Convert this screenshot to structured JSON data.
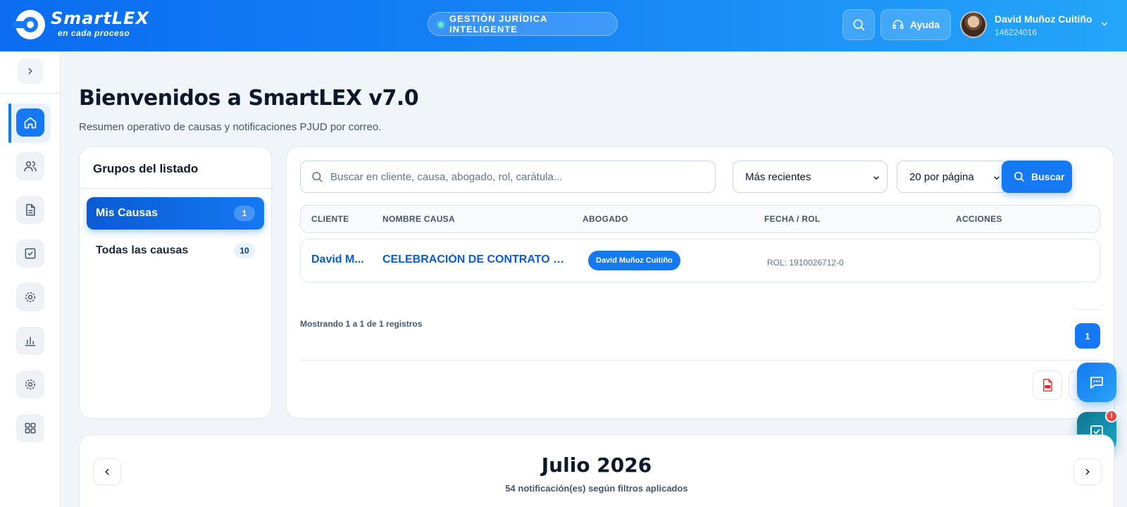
{
  "header": {
    "brand": "SmartLEX",
    "tagline": "en cada proceso",
    "center_pill": "GESTIÓN JURÍDICA INTELIGENTE",
    "help_label": "Ayuda",
    "user_name": "David Muñoz Cuitiño",
    "user_id": "146224016"
  },
  "page": {
    "title": "Bienvenidos a SmartLEX v7.0",
    "subtitle": "Resumen operativo de causas y notificaciones PJUD por correo."
  },
  "groups": {
    "title": "Grupos del listado",
    "items": [
      {
        "label": "Mis Causas",
        "count": "1"
      },
      {
        "label": "Todas las causas",
        "count": "10"
      }
    ]
  },
  "search": {
    "placeholder": "Buscar en cliente, causa, abogado, rol, carátula...",
    "sort_value": "Más recientes",
    "per_page_value": "20 por página",
    "button_label": "Buscar"
  },
  "table": {
    "headers": [
      "CLIENTE",
      "NOMBRE CAUSA",
      "ABOGADO",
      "FECHA / ROL",
      "ACCIONES"
    ],
    "rows": [
      {
        "client": "David M...",
        "cause": "CELEBRACIÓN DE CONTRATO SI...",
        "lawyer": "David Muñoz Cuitiño",
        "rol": "ROL: 1910026712-0"
      }
    ],
    "showing": "Mostrando 1 a 1 de 1 registros",
    "current_page": "1"
  },
  "calendar": {
    "month": "Julio 2026",
    "summary": "54 notificación(es) según filtros aplicados"
  },
  "fab": {
    "alert_badge": "!"
  },
  "colors": {
    "primary": "#1479f2",
    "header_gradient_start": "#0a6cf0",
    "header_gradient_end": "#24a6f8",
    "alert": "#ef4444"
  }
}
